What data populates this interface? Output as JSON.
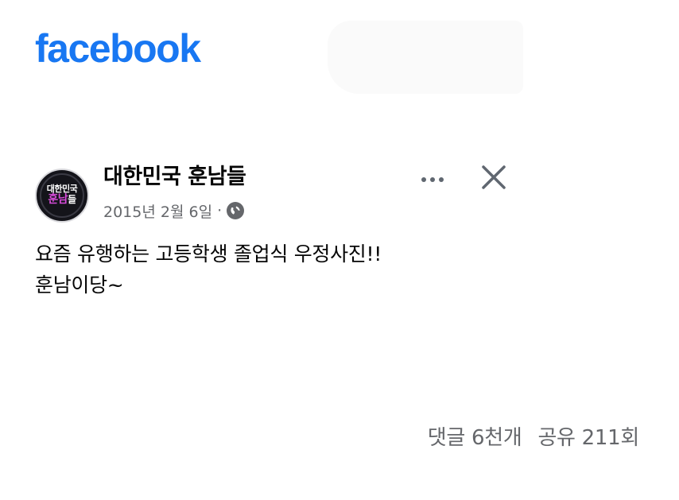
{
  "brand": {
    "logo_text": "facebook"
  },
  "post": {
    "page_name": "대한민국 훈남들",
    "avatar": {
      "top_text": "대한민국",
      "bottom_text_1": "훈남",
      "bottom_text_2": "들"
    },
    "date": "2015년 2월 6일",
    "separator": "·",
    "privacy_icon": "globe-icon",
    "more_icon": "more-dots-icon",
    "close_icon": "close-icon",
    "text_lines": [
      "요즘 유행하는 고등학생 졸업식 우정사진!!",
      "훈남이당~"
    ]
  },
  "stats": {
    "comments": "댓글 6천개",
    "shares": "공유 211회"
  },
  "colors": {
    "brand": "#1877f2",
    "secondary_text": "#65676b",
    "primary_text": "#050505"
  }
}
